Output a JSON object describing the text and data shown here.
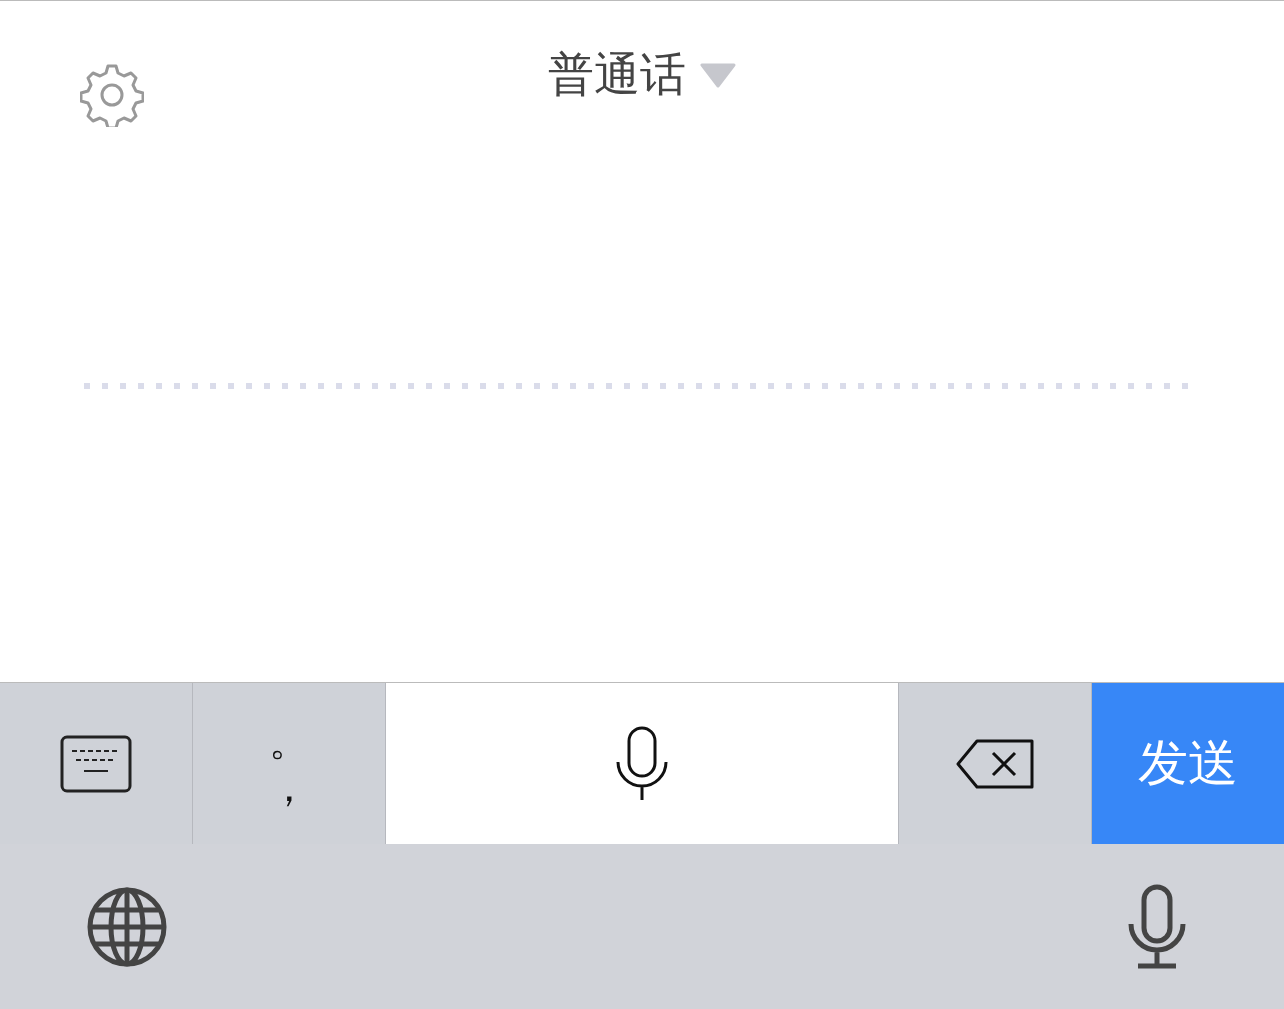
{
  "header": {
    "language": "普通话"
  },
  "keys": [
    {
      "kind": "keyboard"
    },
    {
      "kind": "punctuation",
      "marks": [
        "。",
        "，"
      ]
    },
    {
      "kind": "mic"
    },
    {
      "kind": "backspace"
    },
    {
      "kind": "send",
      "label": "发送"
    }
  ],
  "system_bar": {
    "icons": [
      {
        "kind": "globe"
      },
      {
        "kind": "mic"
      }
    ]
  }
}
